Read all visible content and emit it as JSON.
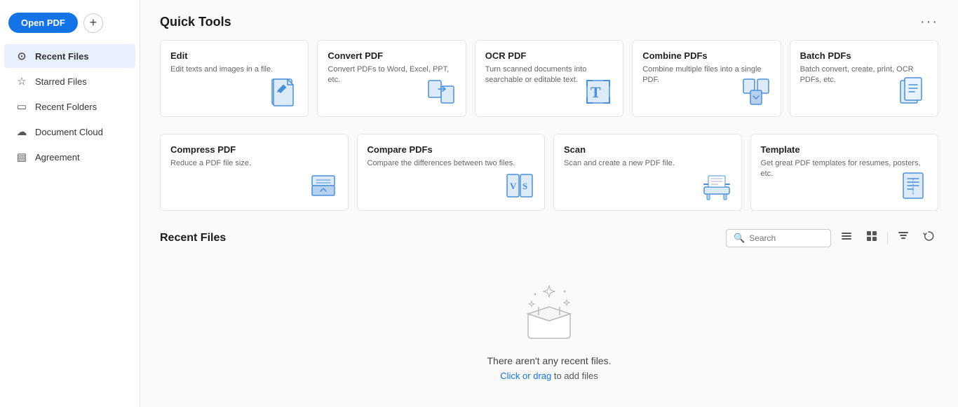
{
  "sidebar": {
    "open_pdf_label": "Open PDF",
    "add_label": "+",
    "items": [
      {
        "id": "recent-files",
        "label": "Recent Files",
        "icon": "⊙",
        "active": true
      },
      {
        "id": "starred-files",
        "label": "Starred Files",
        "icon": "☆",
        "active": false
      },
      {
        "id": "recent-folders",
        "label": "Recent Folders",
        "icon": "🗂",
        "active": false
      },
      {
        "id": "document-cloud",
        "label": "Document Cloud",
        "icon": "☁",
        "active": false
      },
      {
        "id": "agreement",
        "label": "Agreement",
        "icon": "📄",
        "active": false
      }
    ]
  },
  "quick_tools": {
    "title": "Quick Tools",
    "more_icon": "•••",
    "row1": [
      {
        "id": "edit",
        "title": "Edit",
        "desc": "Edit texts and images in a file.",
        "icon": "edit"
      },
      {
        "id": "convert-pdf",
        "title": "Convert PDF",
        "desc": "Convert PDFs to Word, Excel, PPT, etc.",
        "icon": "convert"
      },
      {
        "id": "ocr-pdf",
        "title": "OCR PDF",
        "desc": "Turn scanned documents into searchable or editable text.",
        "icon": "ocr"
      },
      {
        "id": "combine-pdfs",
        "title": "Combine PDFs",
        "desc": "Combine multiple files into a single PDF.",
        "icon": "combine"
      },
      {
        "id": "batch-pdfs",
        "title": "Batch PDFs",
        "desc": "Batch convert, create, print, OCR PDFs, etc.",
        "icon": "batch"
      }
    ],
    "row2": [
      {
        "id": "compress-pdf",
        "title": "Compress PDF",
        "desc": "Reduce a PDF file size.",
        "icon": "compress"
      },
      {
        "id": "compare-pdfs",
        "title": "Compare PDFs",
        "desc": "Compare the differences between two files.",
        "icon": "compare"
      },
      {
        "id": "scan",
        "title": "Scan",
        "desc": "Scan and create a new PDF file.",
        "icon": "scan"
      },
      {
        "id": "template",
        "title": "Template",
        "desc": "Get great PDF templates for resumes, posters, etc.",
        "icon": "template"
      }
    ]
  },
  "recent_files": {
    "title": "Recent Files",
    "search_placeholder": "Search",
    "empty_text": "There aren't any recent files.",
    "empty_action": "Click or drag",
    "empty_action_suffix": " to add files"
  }
}
